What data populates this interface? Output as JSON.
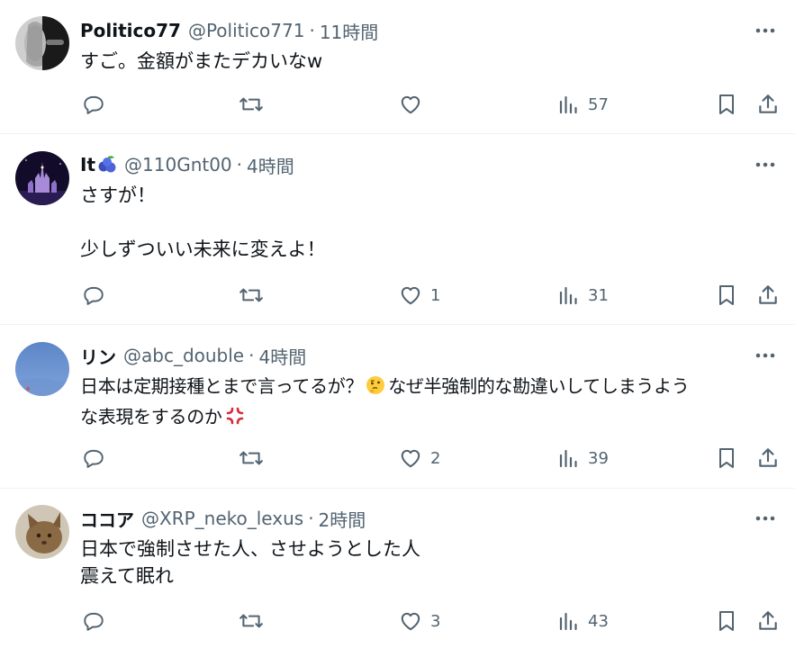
{
  "tweets": [
    {
      "name": "Politico77",
      "handle": "@Politico771",
      "sep": "·",
      "time": "11時間",
      "lines": [
        "すご。金額がまたデカいなw"
      ],
      "reply_count": "",
      "retweet_count": "",
      "like_count": "",
      "views": "57"
    },
    {
      "name": "It",
      "name_emoji": "blueberries-emoji",
      "handle": "@110Gnt00",
      "sep": "·",
      "time": "4時間",
      "lines": [
        "さすが！",
        "",
        "少しずついい未来に変えよ！"
      ],
      "reply_count": "",
      "retweet_count": "",
      "like_count": "1",
      "views": "31"
    },
    {
      "name": "リン",
      "handle": "@abc_double",
      "sep": "·",
      "time": "4時間",
      "line1_a": "日本は定期接種とまで言ってるが？",
      "line1_b": "なぜ半強制的な勘違いしてしまうよう",
      "line2": "な表現をするのか",
      "inline_emojis": [
        "thinking-face-emoji",
        "anger-symbol-emoji"
      ],
      "reply_count": "",
      "retweet_count": "",
      "like_count": "2",
      "views": "39"
    },
    {
      "name": "ココア",
      "handle": "@XRP_neko_lexus",
      "sep": "·",
      "time": "2時間",
      "lines": [
        "日本で強制させた人、させようとした人",
        "震えて眠れ"
      ],
      "reply_count": "",
      "retweet_count": "",
      "like_count": "3",
      "views": "43"
    }
  ],
  "colors": {
    "text": "#0f1419",
    "secondary": "#536471",
    "divider": "#eff3f4"
  }
}
